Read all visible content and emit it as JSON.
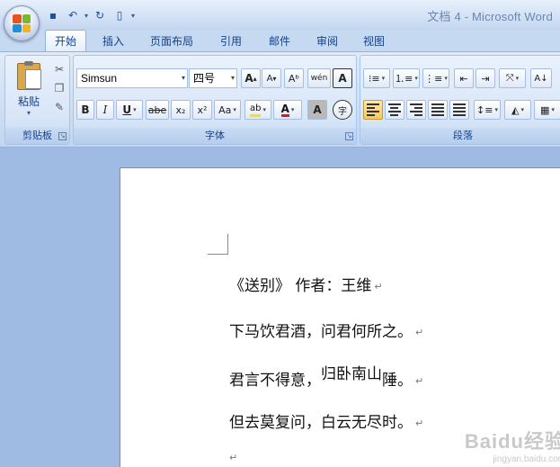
{
  "window": {
    "title": "文档 4 - Microsoft Word"
  },
  "quick_access": {
    "icons": [
      "save-icon",
      "undo-icon",
      "redo-icon",
      "new-doc-icon"
    ]
  },
  "tabs": [
    {
      "label": "开始",
      "active": true
    },
    {
      "label": "插入"
    },
    {
      "label": "页面布局"
    },
    {
      "label": "引用"
    },
    {
      "label": "邮件"
    },
    {
      "label": "审阅"
    },
    {
      "label": "视图"
    }
  ],
  "ribbon": {
    "clipboard": {
      "label": "剪贴板",
      "paste_label": "粘贴"
    },
    "font": {
      "label": "字体",
      "font_name": "Simsun",
      "font_size": "四号",
      "grow": "A",
      "shrink": "A",
      "clear_format": "Aᵇ",
      "phonetic": "wén",
      "char_border": "A",
      "bold": "B",
      "italic": "I",
      "underline": "U",
      "strike": "abe",
      "subscript": "x₂",
      "superscript": "x²",
      "change_case": "Aa",
      "highlight": "ab",
      "font_color": "A",
      "char_shading": "A",
      "enclose": "字"
    },
    "paragraph": {
      "label": "段落"
    }
  },
  "document": {
    "lines": [
      "《送别》 作者：王维",
      "下马饮君酒，问君何所之。",
      "君言不得意，",
      "归卧南山",
      "陲。",
      "但去莫复问，白云无尽时。"
    ],
    "return_mark": "↵"
  },
  "watermark": {
    "title": "Baidu经验",
    "url": "jingyan.baidu.com"
  },
  "colors": {
    "accent": "#15428b",
    "font_color_red": "#e8141c",
    "highlight_yellow": "#ffe000"
  }
}
